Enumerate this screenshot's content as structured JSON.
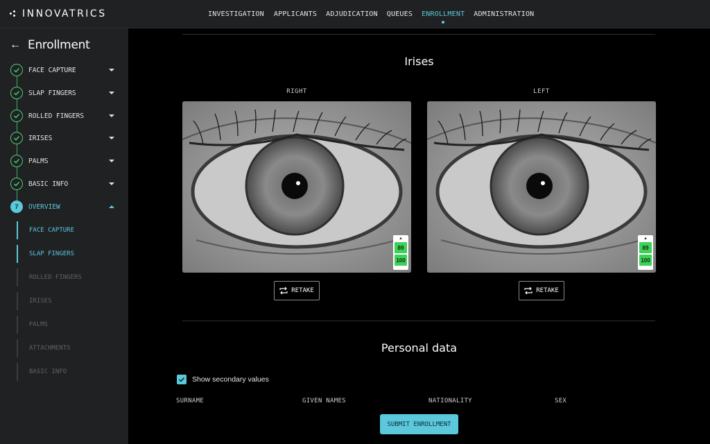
{
  "app": {
    "logo_text": "INNOVATRICS"
  },
  "nav": {
    "items": [
      {
        "label": "INVESTIGATION"
      },
      {
        "label": "APPLICANTS"
      },
      {
        "label": "ADJUDICATION"
      },
      {
        "label": "QUEUES"
      },
      {
        "label": "ENROLLMENT",
        "active": true
      },
      {
        "label": "ADMINISTRATION"
      }
    ]
  },
  "sidebar": {
    "title": "Enrollment",
    "steps": [
      {
        "label": "FACE CAPTURE",
        "status": "done"
      },
      {
        "label": "SLAP FINGERS",
        "status": "done"
      },
      {
        "label": "ROLLED FINGERS",
        "status": "done"
      },
      {
        "label": "IRISES",
        "status": "done"
      },
      {
        "label": "PALMS",
        "status": "done"
      },
      {
        "label": "BASIC INFO",
        "status": "done"
      },
      {
        "label": "OVERVIEW",
        "status": "current",
        "number": "7"
      }
    ],
    "overview_items": [
      {
        "label": "FACE CAPTURE",
        "active": true
      },
      {
        "label": "SLAP FINGERS",
        "active": true
      },
      {
        "label": "ROLLED FINGERS",
        "active": false
      },
      {
        "label": "IRISES",
        "active": false
      },
      {
        "label": "PALMS",
        "active": false
      },
      {
        "label": "ATTACHMENTS",
        "active": false
      },
      {
        "label": "BASIC INFO",
        "active": false
      }
    ]
  },
  "irises": {
    "title": "Irises",
    "right": {
      "label": "RIGHT",
      "scores": [
        "89",
        "100"
      ],
      "retake_label": "RETAKE"
    },
    "left": {
      "label": "LEFT",
      "scores": [
        "89",
        "100"
      ],
      "retake_label": "RETAKE"
    }
  },
  "personal": {
    "title": "Personal data",
    "show_secondary_label": "Show secondary values",
    "show_secondary_checked": true,
    "columns": [
      "SURNAME",
      "GIVEN NAMES",
      "NATIONALITY",
      "SEX"
    ],
    "submit_label": "SUBMIT ENROLLMENT"
  },
  "colors": {
    "accent": "#5cc8dc",
    "success": "#4ecf78",
    "quality": "#3ed158"
  }
}
